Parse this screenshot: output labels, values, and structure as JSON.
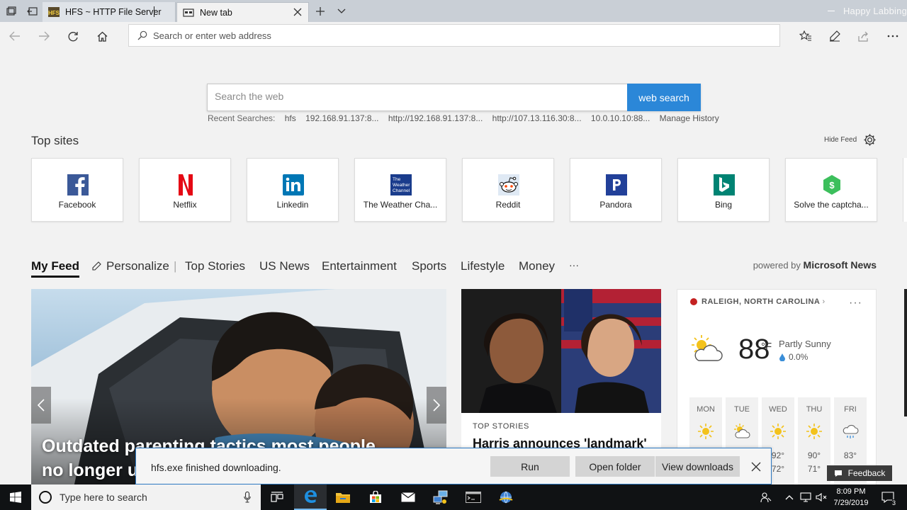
{
  "tabs": [
    {
      "title": "HFS ~ HTTP File Server",
      "favicon": "hfs-icon"
    },
    {
      "title": "New tab",
      "favicon": "new-tab-icon"
    }
  ],
  "window": {
    "user_watermark": "Happy Labbing"
  },
  "address_bar": {
    "placeholder": "Search or enter web address"
  },
  "web_search": {
    "placeholder": "Search the web",
    "button_label": "web search",
    "recent_label": "Recent Searches:",
    "recent_items": [
      "hfs",
      "192.168.91.137:8...",
      "http://192.168.91.137:8...",
      "http://107.13.116.30:8...",
      "10.0.10.10:88..."
    ],
    "manage_history": "Manage History"
  },
  "top_sites": {
    "title": "Top sites",
    "hide_feed": "Hide Feed",
    "sites": [
      {
        "label": "Facebook",
        "color": "#3b5998"
      },
      {
        "label": "Netflix",
        "color": "#e50914"
      },
      {
        "label": "Linkedin",
        "color": "#0077b5"
      },
      {
        "label": "The Weather Cha...",
        "color": "#1a3c8c",
        "logo_text": "The Weather Channel"
      },
      {
        "label": "Reddit",
        "color": "#ff4500"
      },
      {
        "label": "Pandora",
        "color": "#224099"
      },
      {
        "label": "Bing",
        "color": "#008373"
      },
      {
        "label": "Solve the captcha...",
        "color": "#3cbf5c"
      }
    ]
  },
  "feed_nav": {
    "items": [
      "My Feed",
      "Personalize",
      "Top Stories",
      "US News",
      "Entertainment",
      "Sports",
      "Lifestyle",
      "Money",
      "···"
    ],
    "powered_prefix": "powered by",
    "powered_brand": "Microsoft News"
  },
  "cards": {
    "hero": {
      "headline_line1": "Outdated parenting tactics most people",
      "headline_line2": "no longer u"
    },
    "story2": {
      "category": "TOP STORIES",
      "headline": "Harris announces 'landmark'"
    }
  },
  "weather": {
    "location": "RALEIGH, NORTH CAROLINA",
    "temperature": "88",
    "unit": "°F",
    "condition": "Partly Sunny",
    "precipitation": "0.0%",
    "forecast": [
      {
        "day": "MON",
        "high": "",
        "low": "",
        "icon": "sun-icon"
      },
      {
        "day": "TUE",
        "high": "",
        "low": "",
        "icon": "partly-sunny-icon"
      },
      {
        "day": "WED",
        "high": "92°",
        "low": "72°",
        "icon": "sun-icon"
      },
      {
        "day": "THU",
        "high": "90°",
        "low": "71°",
        "icon": "sun-icon"
      },
      {
        "day": "FRI",
        "high": "83°",
        "low": "",
        "icon": "rain-cloud-icon"
      }
    ]
  },
  "download_bar": {
    "message": "hfs.exe finished downloading.",
    "run_label": "Run",
    "open_folder_label": "Open folder",
    "view_downloads_label": "View downloads"
  },
  "feedback": {
    "label": "Feedback"
  },
  "taskbar": {
    "search_placeholder": "Type here to search",
    "time": "8:09 PM",
    "date": "7/29/2019",
    "notifications": "3"
  },
  "colors": {
    "accent": "#2b87d8",
    "taskbar": "#101214",
    "active_underline": "#76b9ed"
  }
}
